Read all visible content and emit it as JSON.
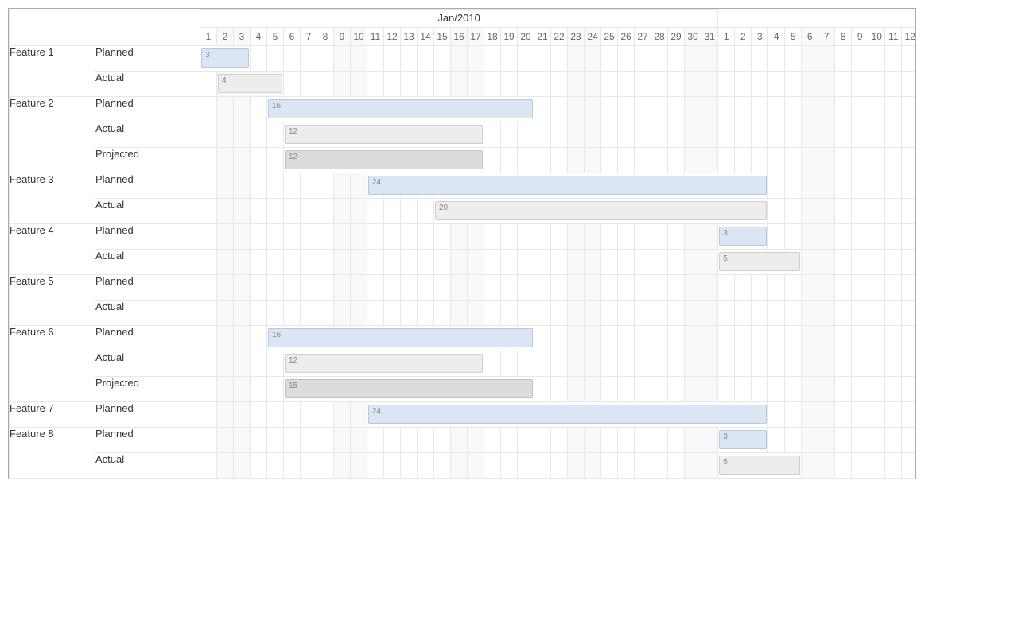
{
  "timeline": {
    "months": [
      {
        "label": "Jan/2010",
        "days": 31
      },
      {
        "label": "",
        "days": 12
      }
    ],
    "days": [
      {
        "n": 1,
        "we": false
      },
      {
        "n": 2,
        "we": true
      },
      {
        "n": 3,
        "we": true
      },
      {
        "n": 4,
        "we": false
      },
      {
        "n": 5,
        "we": false
      },
      {
        "n": 6,
        "we": false
      },
      {
        "n": 7,
        "we": false
      },
      {
        "n": 8,
        "we": false
      },
      {
        "n": 9,
        "we": true
      },
      {
        "n": 10,
        "we": true
      },
      {
        "n": 11,
        "we": false
      },
      {
        "n": 12,
        "we": false
      },
      {
        "n": 13,
        "we": false
      },
      {
        "n": 14,
        "we": false
      },
      {
        "n": 15,
        "we": false
      },
      {
        "n": 16,
        "we": true
      },
      {
        "n": 17,
        "we": true
      },
      {
        "n": 18,
        "we": false
      },
      {
        "n": 19,
        "we": false
      },
      {
        "n": 20,
        "we": false
      },
      {
        "n": 21,
        "we": false
      },
      {
        "n": 22,
        "we": false
      },
      {
        "n": 23,
        "we": true
      },
      {
        "n": 24,
        "we": true
      },
      {
        "n": 25,
        "we": false
      },
      {
        "n": 26,
        "we": false
      },
      {
        "n": 27,
        "we": false
      },
      {
        "n": 28,
        "we": false
      },
      {
        "n": 29,
        "we": false
      },
      {
        "n": 30,
        "we": true
      },
      {
        "n": 31,
        "we": true
      },
      {
        "n": 1,
        "we": false
      },
      {
        "n": 2,
        "we": false
      },
      {
        "n": 3,
        "we": false
      },
      {
        "n": 4,
        "we": false
      },
      {
        "n": 5,
        "we": false
      },
      {
        "n": 6,
        "we": true
      },
      {
        "n": 7,
        "we": true
      },
      {
        "n": 8,
        "we": false
      },
      {
        "n": 9,
        "we": false
      },
      {
        "n": 10,
        "we": false
      },
      {
        "n": 11,
        "we": false
      },
      {
        "n": 12,
        "we": false
      }
    ]
  },
  "track_labels": {
    "planned": "Planned",
    "actual": "Actual",
    "projected": "Projected"
  },
  "features": [
    {
      "name": "Feature 1",
      "tracks": [
        {
          "kind": "planned",
          "bar": {
            "start": 1,
            "span": 3,
            "label": "3"
          }
        },
        {
          "kind": "actual",
          "bar": {
            "start": 2,
            "span": 4,
            "label": "4"
          }
        }
      ]
    },
    {
      "name": "Feature 2",
      "tracks": [
        {
          "kind": "planned",
          "bar": {
            "start": 5,
            "span": 16,
            "label": "16"
          }
        },
        {
          "kind": "actual",
          "bar": {
            "start": 6,
            "span": 12,
            "label": "12"
          }
        },
        {
          "kind": "projected",
          "bar": {
            "start": 6,
            "span": 12,
            "label": "12"
          }
        }
      ]
    },
    {
      "name": "Feature 3",
      "tracks": [
        {
          "kind": "planned",
          "bar": {
            "start": 11,
            "span": 24,
            "label": "24"
          }
        },
        {
          "kind": "actual",
          "bar": {
            "start": 15,
            "span": 20,
            "label": "20"
          }
        }
      ]
    },
    {
      "name": "Feature 4",
      "tracks": [
        {
          "kind": "planned",
          "bar": {
            "start": 32,
            "span": 3,
            "label": "3"
          }
        },
        {
          "kind": "actual",
          "bar": {
            "start": 32,
            "span": 5,
            "label": "5"
          }
        }
      ]
    },
    {
      "name": "Feature 5",
      "tracks": [
        {
          "kind": "planned",
          "bar": null
        },
        {
          "kind": "actual",
          "bar": null
        }
      ]
    },
    {
      "name": "Feature 6",
      "tracks": [
        {
          "kind": "planned",
          "bar": {
            "start": 5,
            "span": 16,
            "label": "16"
          }
        },
        {
          "kind": "actual",
          "bar": {
            "start": 6,
            "span": 12,
            "label": "12"
          }
        },
        {
          "kind": "projected",
          "bar": {
            "start": 6,
            "span": 15,
            "label": "15"
          }
        }
      ]
    },
    {
      "name": "Feature 7",
      "tracks": [
        {
          "kind": "planned",
          "bar": {
            "start": 11,
            "span": 24,
            "label": "24"
          }
        }
      ]
    },
    {
      "name": "Feature 8",
      "tracks": [
        {
          "kind": "planned",
          "bar": {
            "start": 32,
            "span": 3,
            "label": "3"
          }
        },
        {
          "kind": "actual",
          "bar": {
            "start": 32,
            "span": 5,
            "label": "5"
          }
        }
      ]
    }
  ],
  "chart_data": {
    "type": "gantt",
    "title": "",
    "x_axis": {
      "unit": "days",
      "start": "2010-01-01",
      "visible_days": 43
    },
    "legend": [
      "Planned",
      "Actual",
      "Projected"
    ],
    "series": [
      {
        "feature": "Feature 1",
        "track": "Planned",
        "start_day": 1,
        "duration": 3
      },
      {
        "feature": "Feature 1",
        "track": "Actual",
        "start_day": 2,
        "duration": 4
      },
      {
        "feature": "Feature 2",
        "track": "Planned",
        "start_day": 5,
        "duration": 16
      },
      {
        "feature": "Feature 2",
        "track": "Actual",
        "start_day": 6,
        "duration": 12
      },
      {
        "feature": "Feature 2",
        "track": "Projected",
        "start_day": 6,
        "duration": 12
      },
      {
        "feature": "Feature 3",
        "track": "Planned",
        "start_day": 11,
        "duration": 24
      },
      {
        "feature": "Feature 3",
        "track": "Actual",
        "start_day": 15,
        "duration": 20
      },
      {
        "feature": "Feature 4",
        "track": "Planned",
        "start_day": 32,
        "duration": 3
      },
      {
        "feature": "Feature 4",
        "track": "Actual",
        "start_day": 32,
        "duration": 5
      },
      {
        "feature": "Feature 6",
        "track": "Planned",
        "start_day": 5,
        "duration": 16
      },
      {
        "feature": "Feature 6",
        "track": "Actual",
        "start_day": 6,
        "duration": 12
      },
      {
        "feature": "Feature 6",
        "track": "Projected",
        "start_day": 6,
        "duration": 15
      },
      {
        "feature": "Feature 7",
        "track": "Planned",
        "start_day": 11,
        "duration": 24
      },
      {
        "feature": "Feature 8",
        "track": "Planned",
        "start_day": 32,
        "duration": 3
      },
      {
        "feature": "Feature 8",
        "track": "Actual",
        "start_day": 32,
        "duration": 5
      }
    ]
  }
}
